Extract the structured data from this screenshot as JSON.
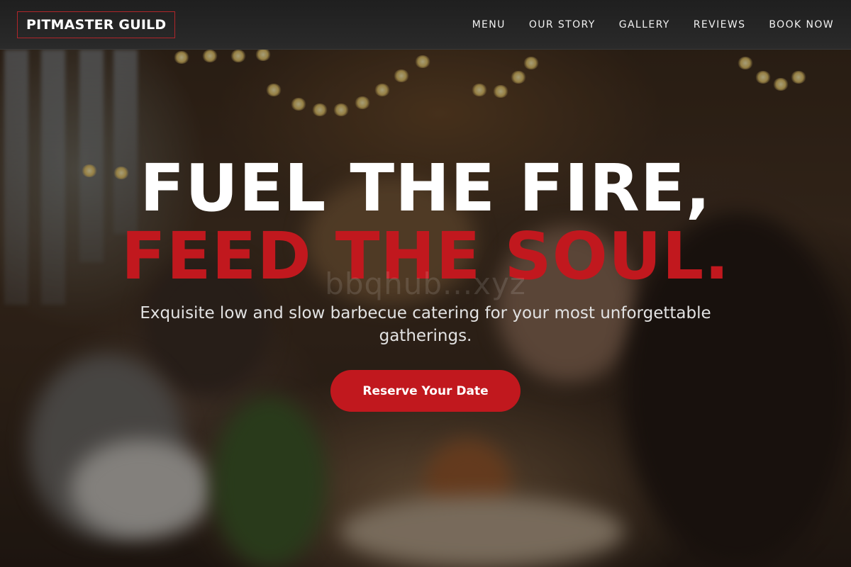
{
  "brand": {
    "name": "PITMASTER GUILD",
    "accent_color": "#c1181e"
  },
  "nav": {
    "items": [
      {
        "label": "MENU"
      },
      {
        "label": "OUR STORY"
      },
      {
        "label": "GALLERY"
      },
      {
        "label": "REVIEWS"
      },
      {
        "label": "BOOK NOW"
      }
    ]
  },
  "hero": {
    "headline_line1": "FUEL THE FIRE,",
    "headline_line2": "FEED THE SOUL.",
    "watermark": "bbqhub...xyz",
    "tagline": "Exquisite low and slow barbecue catering for your most unforgettable gatherings.",
    "cta_label": "Reserve Your Date",
    "background_image": "dimly lit banquet hall with guests raising champagne glasses, string lights overhead"
  }
}
